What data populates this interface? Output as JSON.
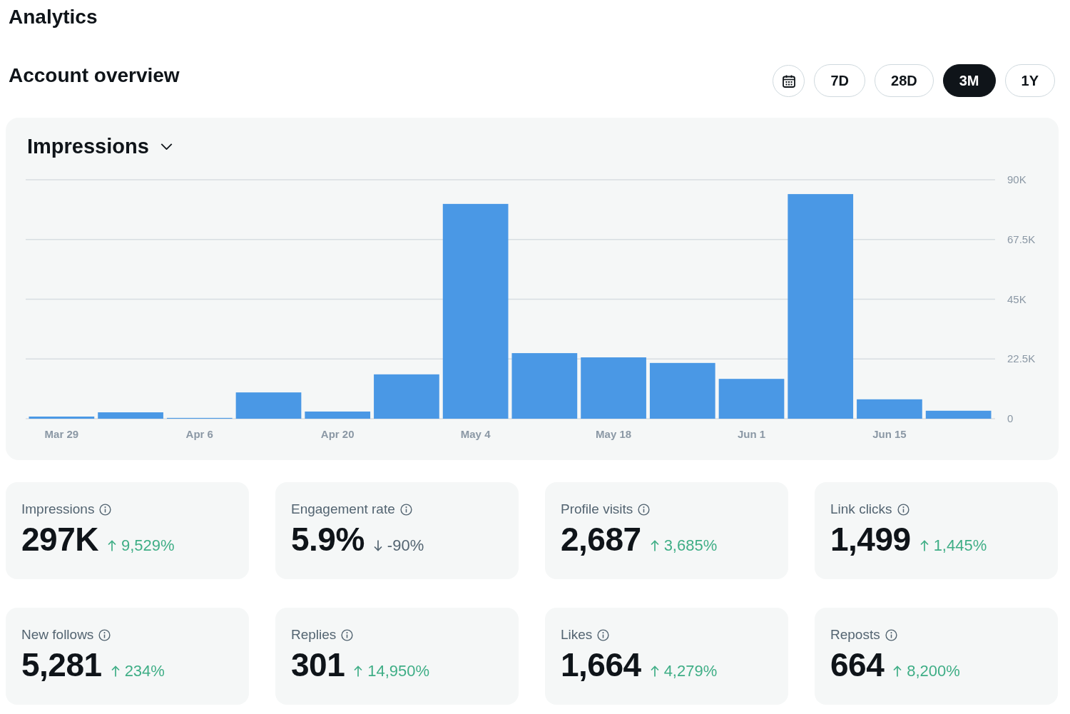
{
  "page": {
    "title": "Analytics"
  },
  "overview": {
    "title": "Account overview",
    "ranges": [
      {
        "label": "7D",
        "selected": false
      },
      {
        "label": "28D",
        "selected": false
      },
      {
        "label": "3M",
        "selected": true
      },
      {
        "label": "1Y",
        "selected": false
      }
    ]
  },
  "chart_card": {
    "metric": "Impressions",
    "chart_data": {
      "type": "bar",
      "categories": [
        "Mar 29",
        null,
        "Apr 6",
        null,
        "Apr 20",
        null,
        "May 4",
        null,
        "May 18",
        null,
        "Jun 1",
        null,
        "Jun 15",
        null
      ],
      "values": [
        800,
        2400,
        300,
        9900,
        2700,
        16700,
        80900,
        24700,
        23100,
        21000,
        15000,
        84600,
        7300,
        3000
      ],
      "ylim": [
        0,
        90000
      ],
      "yticks": [
        {
          "value": 0,
          "label": "0"
        },
        {
          "value": 22500,
          "label": "22.5K"
        },
        {
          "value": 45000,
          "label": "45K"
        },
        {
          "value": 67500,
          "label": "67.5K"
        },
        {
          "value": 90000,
          "label": "90K"
        }
      ],
      "grid": true
    }
  },
  "stats": [
    {
      "label": "Impressions",
      "value": "297K",
      "change": "9,529%",
      "increase": true
    },
    {
      "label": "Engagement rate",
      "value": "5.9%",
      "change": "-90%",
      "increase": false
    },
    {
      "label": "Profile visits",
      "value": "2,687",
      "change": "3,685%",
      "increase": true
    },
    {
      "label": "Link clicks",
      "value": "1,499",
      "change": "1,445%",
      "increase": true
    },
    {
      "label": "New follows",
      "value": "5,281",
      "change": "234%",
      "increase": true
    },
    {
      "label": "Replies",
      "value": "301",
      "change": "14,950%",
      "increase": true
    },
    {
      "label": "Likes",
      "value": "1,664",
      "change": "4,279%",
      "increase": true
    },
    {
      "label": "Reposts",
      "value": "664",
      "change": "8,200%",
      "increase": true
    }
  ]
}
